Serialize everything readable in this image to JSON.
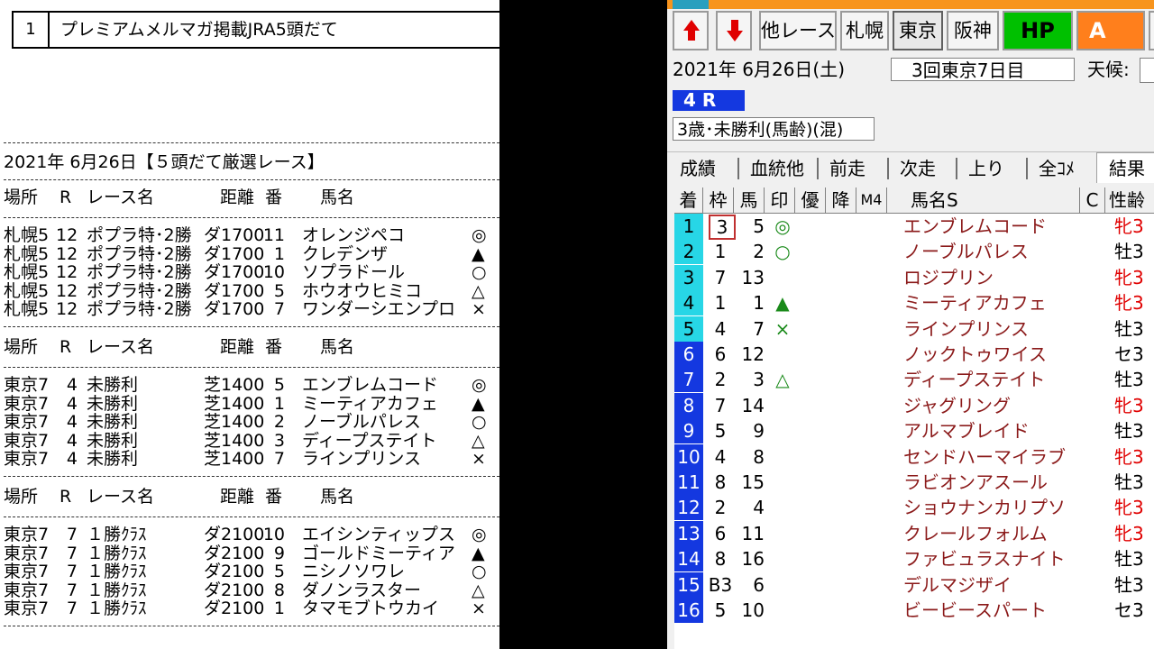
{
  "newsletter": {
    "header_num": "1",
    "header_title": "プレミアムメルマガ掲載JRA5頭だて",
    "section_title": "2021年 6月26日【５頭だて厳選レース】",
    "col_headers": {
      "place": "場所",
      "r": "R",
      "race": "レース名",
      "dist": "距離",
      "num": "番",
      "horse": "馬名"
    },
    "blocks": [
      {
        "rows": [
          {
            "place": "札幌5",
            "r": "12",
            "race": "ポプラ特･2勝",
            "dist": "ダ1700",
            "num": "11",
            "horse": "オレンジペコ",
            "mark": "◎"
          },
          {
            "place": "札幌5",
            "r": "12",
            "race": "ポプラ特･2勝",
            "dist": "ダ1700",
            "num": "1",
            "horse": "クレデンザ",
            "mark": "▲"
          },
          {
            "place": "札幌5",
            "r": "12",
            "race": "ポプラ特･2勝",
            "dist": "ダ1700",
            "num": "10",
            "horse": "ソプラドール",
            "mark": "○"
          },
          {
            "place": "札幌5",
            "r": "12",
            "race": "ポプラ特･2勝",
            "dist": "ダ1700",
            "num": "5",
            "horse": "ホウオウヒミコ",
            "mark": "△"
          },
          {
            "place": "札幌5",
            "r": "12",
            "race": "ポプラ特･2勝",
            "dist": "ダ1700",
            "num": "7",
            "horse": "ワンダーシエンプロ",
            "mark": "×"
          }
        ]
      },
      {
        "rows": [
          {
            "place": "東京7",
            "r": "4",
            "race": "未勝利",
            "dist": "芝1400",
            "num": "5",
            "horse": "エンブレムコード",
            "mark": "◎"
          },
          {
            "place": "東京7",
            "r": "4",
            "race": "未勝利",
            "dist": "芝1400",
            "num": "1",
            "horse": "ミーティアカフェ",
            "mark": "▲"
          },
          {
            "place": "東京7",
            "r": "4",
            "race": "未勝利",
            "dist": "芝1400",
            "num": "2",
            "horse": "ノーブルパレス",
            "mark": "○"
          },
          {
            "place": "東京7",
            "r": "4",
            "race": "未勝利",
            "dist": "芝1400",
            "num": "3",
            "horse": "ディープステイト",
            "mark": "△"
          },
          {
            "place": "東京7",
            "r": "4",
            "race": "未勝利",
            "dist": "芝1400",
            "num": "7",
            "horse": "ラインプリンス",
            "mark": "×"
          }
        ]
      },
      {
        "rows": [
          {
            "place": "東京7",
            "r": "7",
            "race": "１勝ｸﾗｽ",
            "dist": "ダ2100",
            "num": "10",
            "horse": "エイシンティップス",
            "mark": "◎"
          },
          {
            "place": "東京7",
            "r": "7",
            "race": "１勝ｸﾗｽ",
            "dist": "ダ2100",
            "num": "9",
            "horse": "ゴールドミーティア",
            "mark": "▲"
          },
          {
            "place": "東京7",
            "r": "7",
            "race": "１勝ｸﾗｽ",
            "dist": "ダ2100",
            "num": "5",
            "horse": "ニシノソワレ",
            "mark": "○"
          },
          {
            "place": "東京7",
            "r": "7",
            "race": "１勝ｸﾗｽ",
            "dist": "ダ2100",
            "num": "8",
            "horse": "ダノンラスター",
            "mark": "△"
          },
          {
            "place": "東京7",
            "r": "7",
            "race": "１勝ｸﾗｽ",
            "dist": "ダ2100",
            "num": "1",
            "horse": "タマモブトウカイ",
            "mark": "×"
          }
        ]
      }
    ]
  },
  "app": {
    "toolbar": {
      "prev_icon": "arrow-up-icon",
      "next_icon": "arrow-down-icon",
      "other_race": "他レース",
      "sapporo": "札幌",
      "tokyo": "東京",
      "hanshin": "阪神",
      "hp": "HP",
      "a": "A"
    },
    "date": "2021年  6月26日(土)",
    "meeting": "3回東京7日目",
    "weather_label": "天候:",
    "race_number": "4 R",
    "race_condition": "3歳･未勝利(馬齢)(混)",
    "tabs": [
      "成績",
      "血統他",
      "前走",
      "次走",
      "上り",
      "全ｺﾒ",
      "結果"
    ],
    "grid_headers": [
      "着",
      "枠",
      "馬",
      "印",
      "優",
      "降",
      "M4",
      "馬名S",
      "C",
      "性齢"
    ],
    "colors": {
      "accent_blue": "#1438e0",
      "cyan": "#27d6e6",
      "hp_green": "#00c000",
      "a_orange": "#ff7f1c",
      "name_red": "#8b1a1a"
    },
    "results": [
      {
        "chaku": "1",
        "waku": "3",
        "uma": "5",
        "mark": "◎",
        "name": "エンブレムコード",
        "sex": "牝3"
      },
      {
        "chaku": "2",
        "waku": "1",
        "uma": "2",
        "mark": "○",
        "name": "ノーブルパレス",
        "sex": "牡3"
      },
      {
        "chaku": "3",
        "waku": "7",
        "uma": "13",
        "mark": "",
        "name": "ロジプリン",
        "sex": "牝3"
      },
      {
        "chaku": "4",
        "waku": "1",
        "uma": "1",
        "mark": "▲",
        "name": "ミーティアカフェ",
        "sex": "牝3"
      },
      {
        "chaku": "5",
        "waku": "4",
        "uma": "7",
        "mark": "×",
        "name": "ラインプリンス",
        "sex": "牡3"
      },
      {
        "chaku": "6",
        "waku": "6",
        "uma": "12",
        "mark": "",
        "name": "ノックトゥワイス",
        "sex": "セ3"
      },
      {
        "chaku": "7",
        "waku": "2",
        "uma": "3",
        "mark": "△",
        "name": "ディープステイト",
        "sex": "牡3"
      },
      {
        "chaku": "8",
        "waku": "7",
        "uma": "14",
        "mark": "",
        "name": "ジャグリング",
        "sex": "牝3"
      },
      {
        "chaku": "9",
        "waku": "5",
        "uma": "9",
        "mark": "",
        "name": "アルマブレイド",
        "sex": "牡3"
      },
      {
        "chaku": "10",
        "waku": "4",
        "uma": "8",
        "mark": "",
        "name": "センドハーマイラブ",
        "sex": "牝3"
      },
      {
        "chaku": "11",
        "waku": "8",
        "uma": "15",
        "mark": "",
        "name": "ラビオンアスール",
        "sex": "牡3"
      },
      {
        "chaku": "12",
        "waku": "2",
        "uma": "4",
        "mark": "",
        "name": "ショウナンカリプソ",
        "sex": "牝3"
      },
      {
        "chaku": "13",
        "waku": "6",
        "uma": "11",
        "mark": "",
        "name": "クレールフォルム",
        "sex": "牝3"
      },
      {
        "chaku": "14",
        "waku": "8",
        "uma": "16",
        "mark": "",
        "name": "ファビュラスナイト",
        "sex": "牡3"
      },
      {
        "chaku": "15",
        "waku": "B3",
        "uma": "6",
        "mark": "",
        "name": "デルマジザイ",
        "sex": "牡3"
      },
      {
        "chaku": "16",
        "waku": "5",
        "uma": "10",
        "mark": "",
        "name": "ビービースパート",
        "sex": "セ3"
      }
    ]
  }
}
